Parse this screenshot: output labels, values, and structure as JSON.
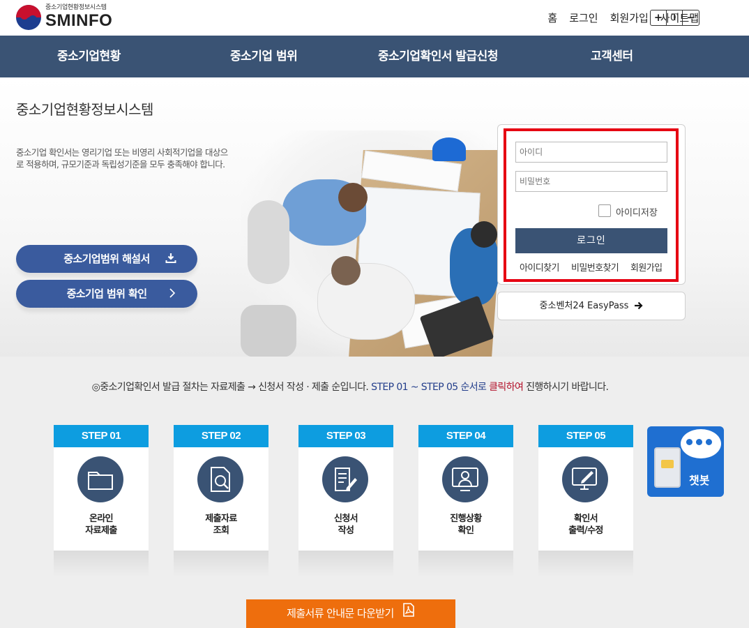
{
  "header": {
    "logo_sub": "중소기업현황정보시스템",
    "logo_main": "SMINFO",
    "util_links": [
      "홈",
      "로그인",
      "회원가입",
      "사이트맵"
    ],
    "font_controls": [
      "+",
      "T",
      "−"
    ]
  },
  "gnb": {
    "menus": [
      "중소기업현황",
      "중소기업 범위",
      "중소기업확인서 발급신청",
      "고객센터"
    ]
  },
  "hero": {
    "title": "중소기업현황정보시스템",
    "description": "중소기업 확인서는 영리기업 또는 비영리 사회적기업을 대상으로 적용하며, 규모기준과 독립성기준을 모두 충족해야 합니다.",
    "btn_guide": "중소기업범위 해설서",
    "btn_check": "중소기업 범위 확인"
  },
  "login": {
    "id_placeholder": "아이디",
    "pw_placeholder": "비밀번호",
    "save_id": "아이디저장",
    "login_button": "로그인",
    "find_id": "아이디찾기",
    "find_pw": "비밀번호찾기",
    "join": "회원가입",
    "easypass": "중소벤처24 EasyPass"
  },
  "notice": {
    "part1": "◎중소기업확인서 발급 절차는 자료제출 → 신청서 작성 · 제출 순입니다.",
    "part2": "STEP 01 ~ STEP 05",
    "part3": "순서로",
    "part4": "클릭하여",
    "part5": "진행하시기 바랍니다."
  },
  "steps": [
    {
      "head": "STEP 01",
      "label": "온라인\n자료제출",
      "icon": "folder-icon"
    },
    {
      "head": "STEP 02",
      "label": "제출자료\n조회",
      "icon": "document-search-icon"
    },
    {
      "head": "STEP 03",
      "label": "신청서\n작성",
      "icon": "form-edit-icon"
    },
    {
      "head": "STEP 04",
      "label": "진행상황\n확인",
      "icon": "person-screen-icon"
    },
    {
      "head": "STEP 05",
      "label": "확인서\n출력/수정",
      "icon": "monitor-pen-icon"
    }
  ],
  "chatbot": {
    "label": "챗봇"
  },
  "download": {
    "label": "제출서류 안내문 다운받기"
  },
  "colors": {
    "nav": "#3a5374",
    "button_blue": "#3a5b9e",
    "step_head": "#0d9de0",
    "highlight_red": "#e60012",
    "download_orange": "#ee6e0d"
  }
}
